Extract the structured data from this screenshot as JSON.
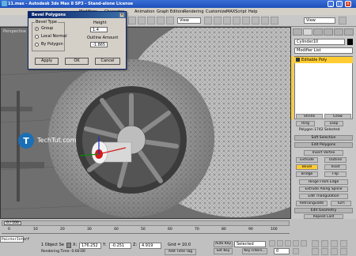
{
  "window": {
    "title": "11.max - Autodesk 3ds Max 8 SP3 - Stand-alone License",
    "controls": [
      "_",
      "□",
      "×"
    ]
  },
  "menu": {
    "items": [
      "Modifiers",
      "Character",
      "Animation",
      "Graph Editors",
      "Rendering",
      "Customize",
      "MAXScript",
      "Help"
    ]
  },
  "toolbar": {
    "view_combo": "View",
    "view_combo2": "View"
  },
  "viewport": {
    "label": "Perspective"
  },
  "dialog": {
    "title": "Bevel Polygons",
    "bevel_type_label": "Bevel Type",
    "options": [
      "Group",
      "Local Normal",
      "By Polygon"
    ],
    "selected_option": "Group",
    "height_label": "Height",
    "height_value": "1.4",
    "outline_label": "Outline Amount",
    "outline_value": "-1.865",
    "apply_label": "Apply",
    "ok_label": "OK",
    "cancel_label": "Cancel"
  },
  "command_panel": {
    "object_name": "Cylinder10",
    "modifier_list": "Modifier List",
    "stack_item": "Editable Poly",
    "shrink": "Shrink",
    "grow": "Grow",
    "ring": "Ring",
    "loop": "Loop",
    "selection_status": "Polygon 1742 Selected",
    "soft_selection": "Soft Selection",
    "edit_polygons": "Edit Polygons",
    "insert_vertex": "Insert Vertex",
    "extrude": "Extrude",
    "outline": "Outline",
    "bevel": "Bevel",
    "inset": "Inset",
    "bridge": "Bridge",
    "flip": "Flip",
    "hinge_from_edge": "Hinge From Edge",
    "extrude_along_spline": "Extrude Along Spline",
    "edit_triangulation": "Edit Triangulation",
    "retriangulate": "Retriangulate",
    "turn": "Turn",
    "edit_geometry": "Edit Geometry",
    "repeat_last": "Repeat Last"
  },
  "timeline": {
    "frame_display": "0 / 100",
    "ticks": [
      "0",
      "10",
      "20",
      "30",
      "40",
      "50",
      "60",
      "70",
      "80",
      "90",
      "100"
    ]
  },
  "status": {
    "selected": "1 Object Se",
    "x": "176.252",
    "y": "-0.251",
    "z": "4.919",
    "grid": "Grid = 10.0",
    "auto_key": "Auto Key",
    "selected_combo": "Selected",
    "set_key": "Set Key",
    "key_filters": "Key Filters...",
    "frame_num": "0",
    "rendering_time": "Rendering Time: 0:00:00",
    "add_time_tag": "Add Time Tag",
    "maxscript": "PainterInterf"
  },
  "watermark": "TechTut.com",
  "colors": {
    "accent_yellow": "#ffcc33",
    "viewport_bg": "#6f6f6f",
    "title_blue": "#1f4fb8"
  }
}
